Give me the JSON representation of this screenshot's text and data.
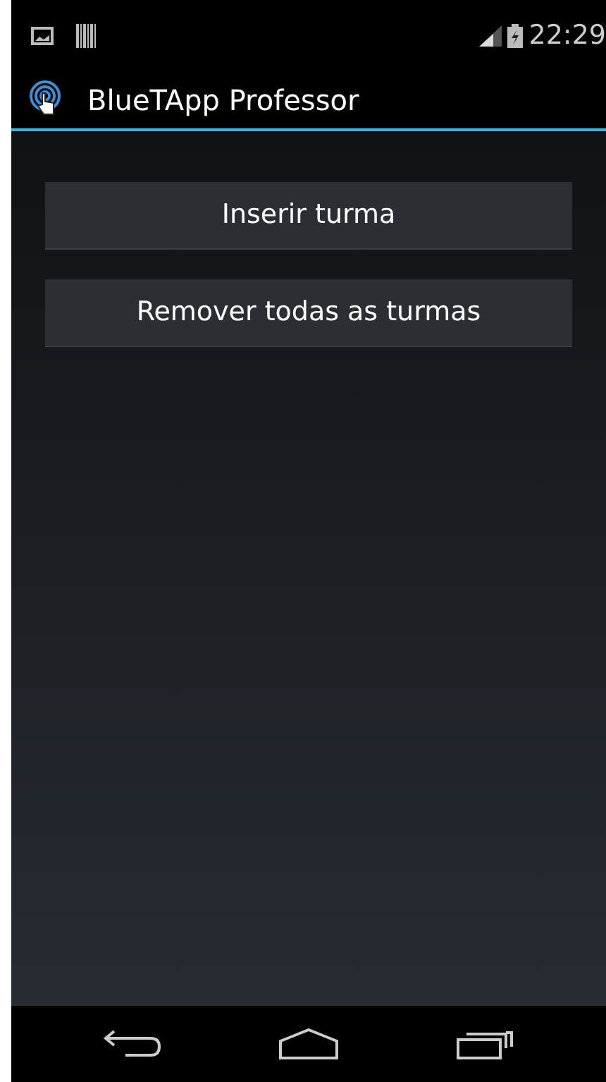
{
  "status_bar": {
    "time": "22:29"
  },
  "action_bar": {
    "title": "BlueTApp Professor"
  },
  "buttons": [
    {
      "label": "Inserir turma"
    },
    {
      "label": "Remover todas as turmas"
    }
  ]
}
